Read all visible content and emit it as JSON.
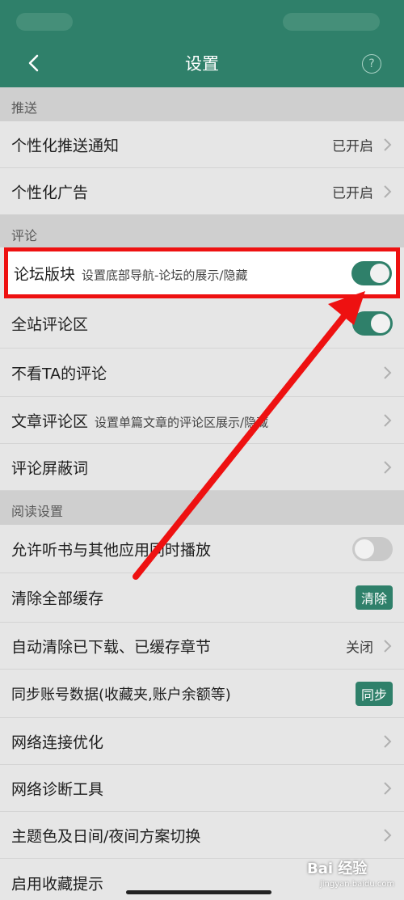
{
  "header": {
    "title": "设置"
  },
  "sections": {
    "push": "推送",
    "comments": "评论",
    "reading": "阅读设置"
  },
  "push": {
    "personal_push": {
      "label": "个性化推送通知",
      "value": "已开启"
    },
    "personal_ads": {
      "label": "个性化广告",
      "value": "已开启"
    }
  },
  "comments": {
    "forum": {
      "label": "论坛版块",
      "desc": "设置底部导航-论坛的展示/隐藏",
      "toggle": "on"
    },
    "site_comments": {
      "label": "全站评论区",
      "toggle": "on"
    },
    "ignore_ta": {
      "label": "不看TA的评论"
    },
    "article_comments": {
      "label": "文章评论区",
      "desc": "设置单篇文章的评论区展示/隐藏"
    },
    "blocked_words": {
      "label": "评论屏蔽词"
    }
  },
  "reading": {
    "audio_mix": {
      "label": "允许听书与其他应用同时播放",
      "toggle": "off"
    },
    "clear_cache": {
      "label": "清除全部缓存",
      "button": "清除"
    },
    "auto_clear": {
      "label": "自动清除已下载、已缓存章节",
      "value": "关闭"
    },
    "sync_account": {
      "label": "同步账号数据(收藏夹,账户余额等)",
      "button": "同步"
    },
    "network_opt": {
      "label": "网络连接优化"
    },
    "network_diag": {
      "label": "网络诊断工具"
    },
    "theme": {
      "label": "主题色及日间/夜间方案切换"
    },
    "favorite_tip": {
      "label": "启用收藏提示"
    }
  },
  "watermark": {
    "brand": "Bai 经验",
    "url": "jingyan.baidu.com"
  },
  "colors": {
    "accent": "#2f806a",
    "highlight": "#ee1111",
    "background": "#e6e6e6"
  }
}
